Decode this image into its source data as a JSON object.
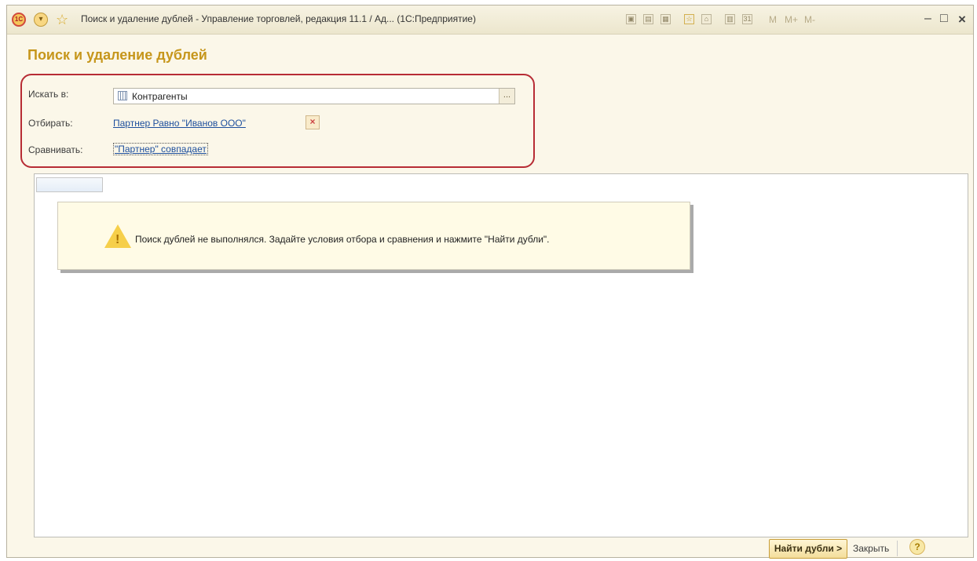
{
  "window": {
    "title": "Поиск и удаление дублей - Управление торговлей, редакция 11.1 / Ад... (1С:Предприятие)",
    "logo_text": "1С",
    "menu_icon": "▾",
    "minimize": "–",
    "maximize": "□",
    "close": "×"
  },
  "toolbar": {
    "tools": [
      "save-icon",
      "print-icon",
      "preview-icon",
      "favorite-icon",
      "history-icon",
      "calculator-icon",
      "calendar-icon"
    ],
    "memory_buttons": [
      "M",
      "M+",
      "M-"
    ]
  },
  "form": {
    "title": "Поиск и удаление дублей",
    "search_in_label": "Искать в:",
    "search_in_value": "Контрагенты",
    "choose_button": "...",
    "filter_label": "Отбирать:",
    "filter_value": "Партнер Равно \"Иванов ООО\"",
    "clear_filter": "×",
    "compare_label": "Сравнивать:",
    "compare_value": "\"Партнер\" совпадает"
  },
  "message": {
    "text": "Поиск дублей не выполнялся.  Задайте условия отбора и сравнения и нажмите \"Найти дубли\".",
    "icon": "!"
  },
  "footer": {
    "find_button": "Найти дубли >",
    "close_button": "Закрыть",
    "help_button": "?"
  },
  "colors": {
    "heading": "#c6961b",
    "outline": "#b72c35",
    "link": "#1d4f9d"
  }
}
